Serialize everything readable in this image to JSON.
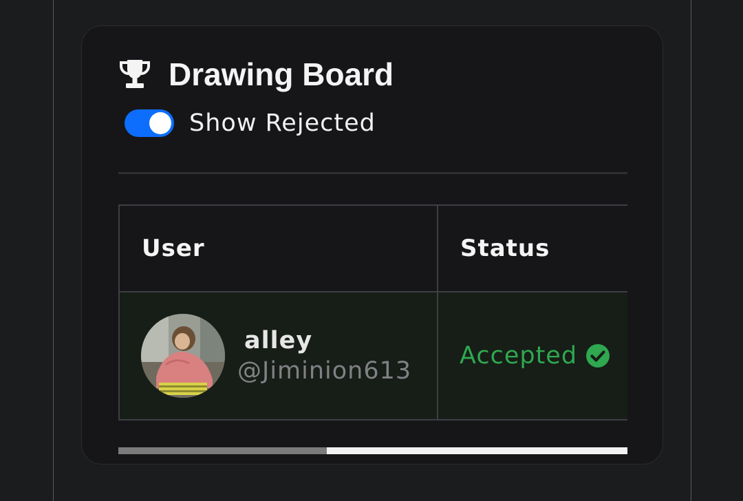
{
  "card": {
    "title": "Drawing Board",
    "title_icon": "trophy-icon"
  },
  "filter": {
    "toggle_label": "Show Rejected",
    "toggle_on": true,
    "toggle_color": "#0d6efd"
  },
  "table": {
    "columns": [
      "User",
      "Status"
    ],
    "rows": [
      {
        "name": "alley",
        "handle": "@Jiminion613",
        "avatar": "user-avatar-photo",
        "status": "Accepted",
        "status_icon": "check-circle-icon",
        "status_color": "#2fa84f"
      }
    ]
  },
  "scrollbar": {
    "position_fraction": 0.41
  }
}
